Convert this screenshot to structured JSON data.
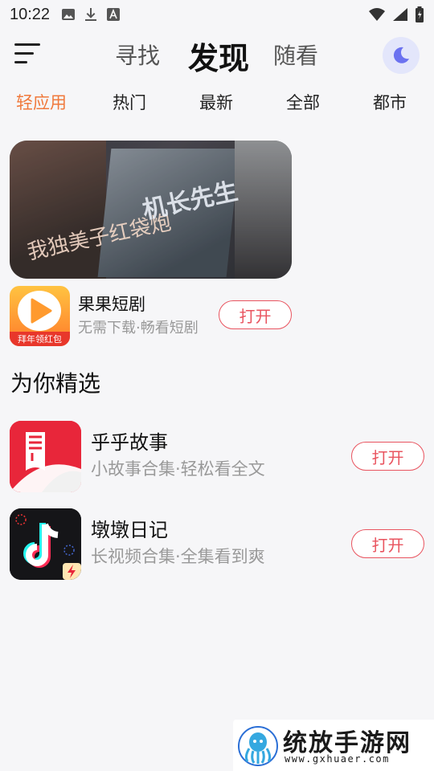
{
  "status_bar": {
    "time": "10:22",
    "left_icons": [
      "image-icon",
      "download-icon",
      "a-icon"
    ],
    "right_icons": [
      "wifi-icon",
      "signal-icon",
      "battery-icon"
    ]
  },
  "top_nav": {
    "tabs": [
      {
        "label": "寻找",
        "active": false
      },
      {
        "label": "发现",
        "active": true
      },
      {
        "label": "随看",
        "active": false
      }
    ]
  },
  "categories": [
    {
      "label": "轻应用",
      "active": true
    },
    {
      "label": "热门",
      "active": false
    },
    {
      "label": "最新",
      "active": false
    },
    {
      "label": "全部",
      "active": false
    },
    {
      "label": "都市",
      "active": false
    }
  ],
  "banner": {
    "caption_a": "我独美子红袋炮",
    "caption_b": "机长先生"
  },
  "featured_app": {
    "name": "果果短剧",
    "description": "无需下载·畅看短剧",
    "ribbon": "拜年领红包",
    "button": "打开"
  },
  "section_title": "为你精选",
  "apps": [
    {
      "name": "乎乎故事",
      "description": "小故事合集·轻松看全文",
      "button": "打开"
    },
    {
      "name": "墩墩日记",
      "description": "长视频合集·全集看到爽",
      "button": "打开"
    }
  ],
  "watermark": {
    "title": "统放手游网",
    "url": "www.gxhuaer.com"
  },
  "colors": {
    "accent": "#f0793c",
    "button": "#e9545f",
    "theme_button_bg": "#e3e6fb",
    "moon": "#6b72f0"
  }
}
